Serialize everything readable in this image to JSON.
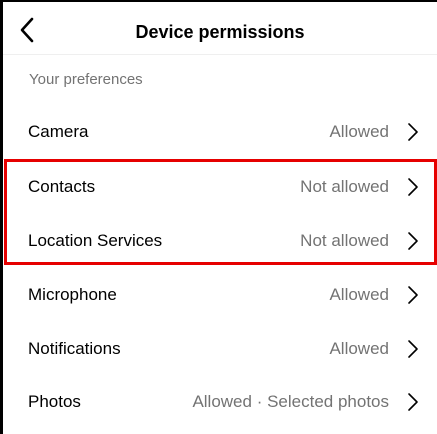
{
  "header": {
    "title": "Device permissions",
    "back_icon": "chevron-left-icon"
  },
  "section": {
    "label": "Your preferences"
  },
  "permissions": [
    {
      "label": "Camera",
      "status": "Allowed"
    },
    {
      "label": "Contacts",
      "status": "Not allowed"
    },
    {
      "label": "Location Services",
      "status": "Not allowed"
    },
    {
      "label": "Microphone",
      "status": "Allowed"
    },
    {
      "label": "Notifications",
      "status": "Allowed"
    },
    {
      "label": "Photos",
      "status": "Allowed · Selected photos"
    }
  ],
  "row_icon": "chevron-right-icon",
  "colors": {
    "highlight": "#e60000",
    "secondary_text": "#737373",
    "primary_text": "#000000"
  }
}
